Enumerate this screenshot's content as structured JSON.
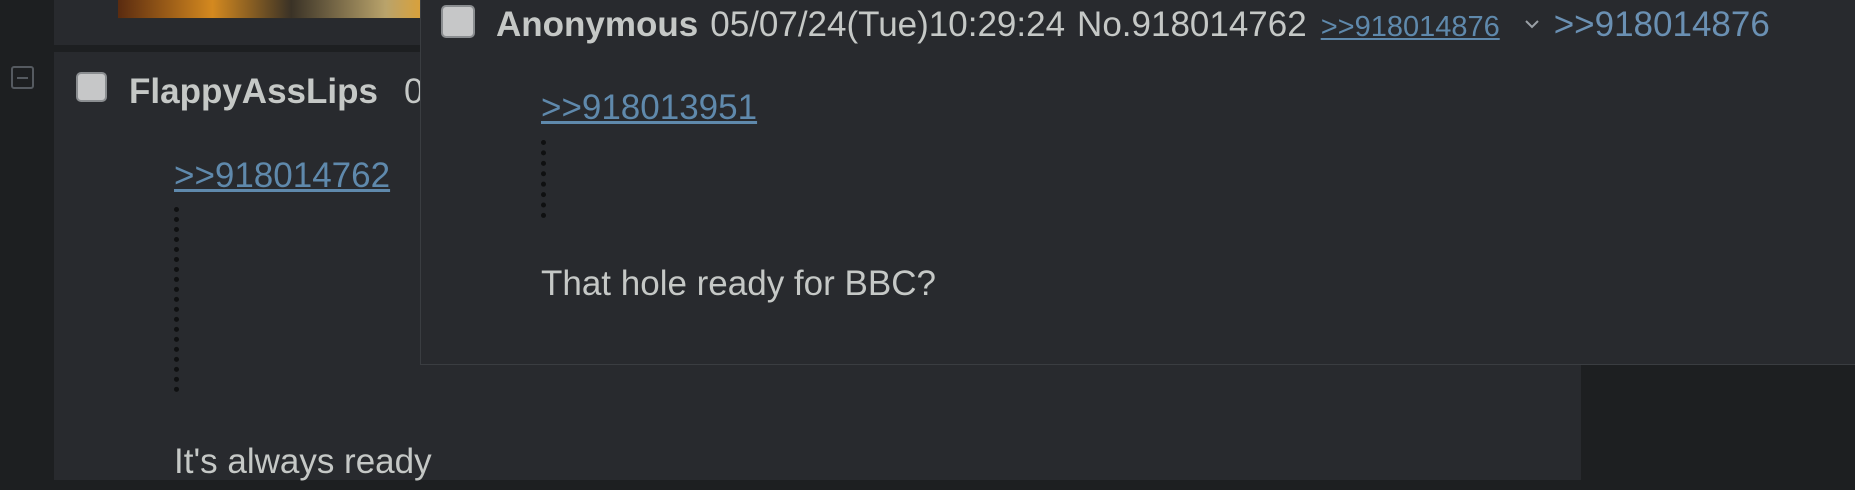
{
  "reply": {
    "name": "FlappyAssLips",
    "date_partial": "0",
    "quote_link": ">>918014762",
    "message": "It's always ready"
  },
  "popup": {
    "name": "Anonymous",
    "datetime": "05/07/24(Tue)10:29:24",
    "post_number": "No.918014762",
    "backlink": ">>918014876",
    "backlink_repeat": ">>918014876",
    "quote_link": ">>918013951",
    "message": "That hole ready for BBC?"
  },
  "icons": {
    "collapse": "minus-square-icon",
    "menu": "chevron-down-icon"
  },
  "colors": {
    "background": "#1d1f21",
    "post_background": "#282a2e",
    "text": "#c5c8c6",
    "link": "#5f89ac"
  }
}
